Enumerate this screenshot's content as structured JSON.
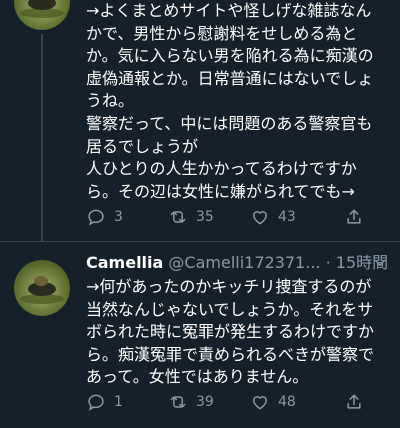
{
  "tweets": [
    {
      "lines": [
        "→よくまとめサイトや怪しげな雑誌なん",
        "かで、男性から慰謝料をせしめる為と",
        "か。気に入らない男を陥れる為に痴漢の",
        "虚偽通報とか。日常普通にはないでしょ",
        "うね。",
        "警察だって、中には問題のある警察官も",
        "居るでしょうが",
        "人ひとりの人生かかってるわけですか",
        "ら。その辺は女性に嫌がられてでも→"
      ],
      "reply_count": "3",
      "retweet_count": "35",
      "like_count": "43"
    },
    {
      "name": "Camellia",
      "handle": "@Camelli172371...",
      "dot": "·",
      "time": "15時間",
      "lines": [
        "→何があったのかキッチリ捜査するのが",
        "当然なんじゃないでしょうか。それをサ",
        "ボられた時に冤罪が発生するわけですか",
        "ら。痴漢冤罪で責められるべきが警察で",
        "あって。女性ではありません。"
      ],
      "reply_count": "1",
      "retweet_count": "39",
      "like_count": "48"
    }
  ],
  "icons": {
    "reply": "reply-icon",
    "retweet": "retweet-icon",
    "like": "heart-icon",
    "share": "share-icon",
    "more": "chevron-down-icon"
  },
  "colors": {
    "background": "#15202b",
    "text": "#ffffff",
    "muted": "#8899a6",
    "divider": "#38444d"
  }
}
